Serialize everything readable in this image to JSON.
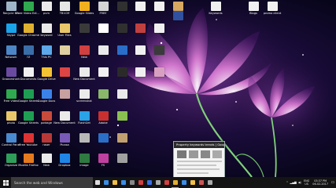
{
  "desktop": {
    "icons": [
      {
        "label": "Recycle Bin",
        "icon": "recycle-bin-icon",
        "color": "#9fb4c8"
      },
      {
        "label": "Skype",
        "icon": "skype-icon",
        "color": "#1aa3e8"
      },
      {
        "label": "Network",
        "icon": "network-icon",
        "color": "#4c86c6"
      },
      {
        "label": "Grooveshark",
        "icon": "app-icon",
        "color": "#6a4aa0"
      },
      {
        "label": "Free Video",
        "icon": "app-icon",
        "color": "#2fa84f"
      },
      {
        "label": "photo",
        "icon": "folder-icon",
        "color": "#e8c66a"
      },
      {
        "label": "Control Panel",
        "icon": "control-panel-icon",
        "color": "#4a8ad0"
      },
      {
        "label": "Organize",
        "icon": "app-icon",
        "color": "#2f9e5a"
      },
      {
        "label": "Free Video Editor",
        "icon": "app-icon",
        "color": "#2fa84f"
      },
      {
        "label": "Google Chrome",
        "icon": "chrome-icon",
        "color": "#e0b030"
      },
      {
        "label": "7Z",
        "icon": "app-icon",
        "color": "#3a6ea8"
      },
      {
        "label": "Documents",
        "icon": "document-icon",
        "color": "#f0f0f0"
      },
      {
        "label": "Google Sheets",
        "icon": "sheets-icon",
        "color": "#1e9e52"
      },
      {
        "label": "Google Sheets",
        "icon": "sheets-icon",
        "color": "#1e9e52"
      },
      {
        "label": "Free Youtube",
        "icon": "app-icon",
        "color": "#d33"
      },
      {
        "label": "Mozilla Firefox",
        "icon": "firefox-icon",
        "color": "#e67a1e"
      },
      {
        "label": "pvm",
        "icon": "document-icon",
        "color": "#eaeaea"
      },
      {
        "label": "keyword",
        "icon": "document-icon",
        "color": "#eaeaea"
      },
      {
        "label": "This PC",
        "icon": "this-pc-icon",
        "color": "#5ca8e8"
      },
      {
        "label": "Google Drive",
        "icon": "drive-icon",
        "color": "#f2c232"
      },
      {
        "label": "Google Docs",
        "icon": "docs-icon",
        "color": "#3b82e8"
      },
      {
        "label": "pottage",
        "icon": "app-icon",
        "color": "#c84a3a"
      },
      {
        "label": "raser",
        "icon": "app-icon",
        "color": "#b83838"
      },
      {
        "label": "New",
        "icon": "document-icon",
        "color": "#eaeaea"
      },
      {
        "label": "TB1CM",
        "icon": "app-icon",
        "color": "#e6e6e6"
      },
      {
        "label": "User Files",
        "icon": "folder-icon",
        "color": "#e8c66a"
      },
      {
        "label": "",
        "icon": "app-icon",
        "color": "#e0d0a0"
      },
      {
        "label": "",
        "icon": "app-icon",
        "color": "#d44"
      },
      {
        "label": "",
        "icon": "app-icon",
        "color": "#c8a0a0"
      },
      {
        "label": "New Document",
        "icon": "document-icon",
        "color": "#eaeaea"
      },
      {
        "label": "Picasa",
        "icon": "app-icon",
        "color": "#7a5ab8"
      },
      {
        "label": "Dropbox",
        "icon": "dropbox-icon",
        "color": "#1f86e6"
      },
      {
        "label": "Google Slides",
        "icon": "slides-icon",
        "color": "#f2b01e"
      },
      {
        "label": "",
        "icon": "app-icon",
        "color": "#3a3a3a"
      },
      {
        "label": "New",
        "icon": "app-icon",
        "color": "#d04040"
      },
      {
        "label": "New Document",
        "icon": "document-icon",
        "color": "#eaeaea"
      },
      {
        "label": "screenshot",
        "icon": "document-icon",
        "color": "#eaeaea"
      },
      {
        "label": "FlashGet",
        "icon": "app-icon",
        "color": "#2aa2e6"
      },
      {
        "label": "",
        "icon": "app-icon",
        "color": "#b8b8b8"
      },
      {
        "label": "image",
        "icon": "app-icon",
        "color": "#2e7a40"
      },
      {
        "label": "FREE",
        "icon": "app-icon",
        "color": "#d4d4d4"
      },
      {
        "label": "",
        "icon": "app-icon",
        "color": "#ffffff"
      },
      {
        "label": "",
        "icon": "document-icon",
        "color": "#eaeaea"
      },
      {
        "label": "",
        "icon": "app-icon",
        "color": "#f0f0f0"
      },
      {
        "label": "",
        "icon": "app-icon",
        "color": "#88b868"
      },
      {
        "label": "Adobe",
        "icon": "app-icon",
        "color": "#c83030"
      },
      {
        "label": "",
        "icon": "app-icon",
        "color": "#2a6ec8"
      },
      {
        "label": "FS",
        "icon": "app-icon",
        "color": "#c040a0"
      },
      {
        "label": "",
        "icon": "app-icon",
        "color": "#303030"
      },
      {
        "label": "",
        "icon": "app-icon",
        "color": "#303030"
      },
      {
        "label": "",
        "icon": "app-icon",
        "color": "#2a6ec8"
      },
      {
        "label": "",
        "icon": "app-icon",
        "color": "#2a2a2a"
      },
      {
        "label": "",
        "icon": "document-icon",
        "color": "#eaeaea"
      },
      {
        "label": "",
        "icon": "app-icon",
        "color": "#8ac050"
      },
      {
        "label": "",
        "icon": "app-icon",
        "color": "#c0a070"
      },
      {
        "label": "",
        "icon": "app-icon",
        "color": "#a0a0a0"
      },
      {
        "label": "",
        "icon": "document-icon",
        "color": "#eaeaea"
      },
      {
        "label": "",
        "icon": "app-icon",
        "color": "#e0e0e0"
      },
      {
        "label": "",
        "icon": "app-icon",
        "color": "#ffffff"
      },
      {
        "label": "",
        "icon": "app-icon",
        "color": "#eaeaea"
      },
      {
        "label": "",
        "icon": "app-icon",
        "color": "#b0b0b0"
      },
      {
        "label": "",
        "icon": "app-icon",
        "color": "#4a4a4a"
      }
    ],
    "extra_icons": [
      {
        "label": "",
        "icon": "document-icon",
        "color": "#f0f0f0"
      },
      {
        "label": "",
        "icon": "document-icon",
        "color": "#f0f0f0"
      },
      {
        "label": "",
        "icon": "app-icon",
        "color": "#d8a860"
      },
      {
        "label": "",
        "icon": "app-icon",
        "color": "#c04040"
      },
      {
        "label": "",
        "icon": "document-icon",
        "color": "#f0f0f0"
      },
      {
        "label": "",
        "icon": "document-icon",
        "color": "#f0f0f0"
      },
      {
        "label": "",
        "icon": "app-icon",
        "color": "#3a3a3a"
      },
      {
        "label": "",
        "icon": "document-icon",
        "color": "#f0f0f0"
      },
      {
        "label": "",
        "icon": "app-icon",
        "color": "#d8a0c0"
      },
      {
        "label": "",
        "icon": "app-icon",
        "color": "#3050a0"
      },
      {
        "label": "Keywords",
        "icon": "document-icon",
        "color": "#f0f0f0"
      },
      {
        "label": "Blogs",
        "icon": "document-icon",
        "color": "#f0f0f0"
      },
      {
        "label": "promo client",
        "icon": "document-icon",
        "color": "#f0f0f0"
      }
    ]
  },
  "thumbnail": {
    "title": "Property keywords trends | Google..."
  },
  "taskbar": {
    "search_placeholder": "Search the web and Windows",
    "apps": [
      {
        "icon": "task-view-icon",
        "color": "#dddddd"
      },
      {
        "icon": "edge-icon",
        "color": "#3a8ee6"
      },
      {
        "icon": "file-explorer-icon",
        "color": "#f2c04a"
      },
      {
        "icon": "store-icon",
        "color": "#3a8ee6"
      },
      {
        "icon": "app-icon",
        "color": "#888888"
      },
      {
        "icon": "app-icon",
        "color": "#d04040"
      },
      {
        "icon": "app-icon",
        "color": "#3a6ee6"
      },
      {
        "icon": "app-icon",
        "color": "#aaaaaa"
      },
      {
        "icon": "app-icon",
        "color": "#d04040"
      },
      {
        "icon": "chrome-icon",
        "color": "#e0b030"
      },
      {
        "icon": "app-icon",
        "color": "#3a8ee6"
      },
      {
        "icon": "app-icon",
        "color": "#f2c04a"
      },
      {
        "icon": "app-icon",
        "color": "#cc5555"
      },
      {
        "icon": "app-icon",
        "color": "#aaaaaa"
      }
    ],
    "tray": {
      "lang": "ENG",
      "region": "US",
      "time": "03:37 PM",
      "date": "06-02-2017"
    }
  }
}
